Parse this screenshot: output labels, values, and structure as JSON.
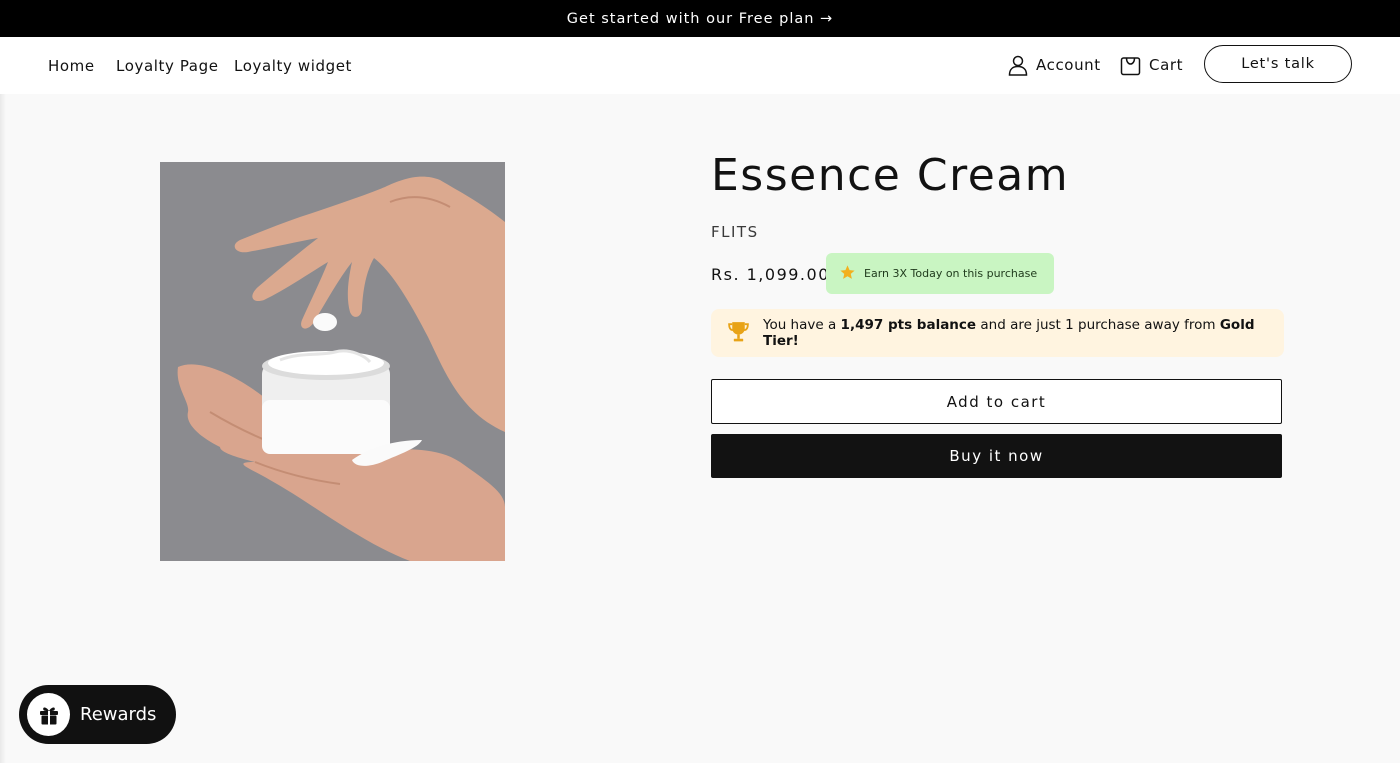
{
  "announcement": {
    "text": "Get started with our Free plan →"
  },
  "nav": {
    "items": [
      {
        "label": "Home"
      },
      {
        "label": "Loyalty Page"
      },
      {
        "label": "Loyalty widget"
      }
    ],
    "account_label": "Account",
    "cart_label": "Cart",
    "talk_label": "Let's talk"
  },
  "product": {
    "title": "Essence Cream",
    "vendor": "FLITS",
    "price": "Rs. 1,099.00",
    "image_alt": "Hands applying cream from a white jar"
  },
  "earn_badge": {
    "text": "Earn 3X Today on this purchase",
    "icon": "star-icon"
  },
  "tier_message": {
    "icon": "trophy-icon",
    "part1": "You have a ",
    "points": "1,497 pts balance",
    "part2": " and are just 1 purchase away from ",
    "tier": "Gold Tier!"
  },
  "buttons": {
    "add_to_cart": "Add to cart",
    "buy_now": "Buy it now"
  },
  "rewards": {
    "label": "Rewards",
    "icon": "gift-icon"
  },
  "colors": {
    "announcement_bg": "#000000",
    "earn_badge_bg": "#c9f5c2",
    "tier_box_bg": "#fff4e0",
    "buy_button_bg": "#121212"
  }
}
